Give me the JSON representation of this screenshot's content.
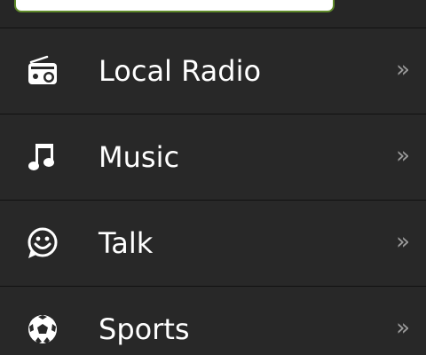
{
  "menu": {
    "items": [
      {
        "label": "Local Radio",
        "icon": "radio-icon",
        "chevron": "»"
      },
      {
        "label": "Music",
        "icon": "music-note-icon",
        "chevron": "»"
      },
      {
        "label": "Talk",
        "icon": "smiley-speech-icon",
        "chevron": "»"
      },
      {
        "label": "Sports",
        "icon": "soccer-ball-icon",
        "chevron": "»"
      }
    ]
  },
  "colors": {
    "background": "#282828",
    "divider": "#111111",
    "text": "#ffffff",
    "chevron": "#9a9a9a",
    "search_border": "#5f8a2a"
  }
}
